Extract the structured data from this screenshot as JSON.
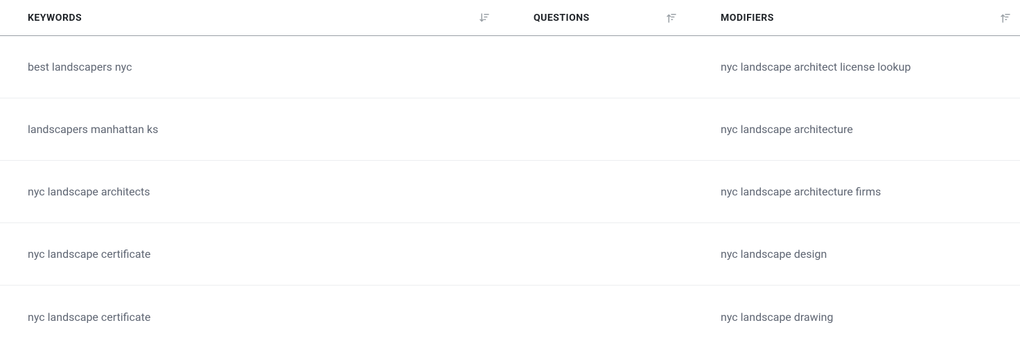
{
  "columns": {
    "keywords": {
      "label": "KEYWORDS"
    },
    "questions": {
      "label": "QUESTIONS"
    },
    "modifiers": {
      "label": "MODIFIERS"
    }
  },
  "rows": [
    {
      "keywords": "best landscapers nyc",
      "questions": "",
      "modifiers": "nyc landscape architect license lookup"
    },
    {
      "keywords": "landscapers manhattan ks",
      "questions": "",
      "modifiers": "nyc landscape architecture"
    },
    {
      "keywords": "nyc landscape architects",
      "questions": "",
      "modifiers": "nyc landscape architecture firms"
    },
    {
      "keywords": "nyc landscape certificate",
      "questions": "",
      "modifiers": "nyc landscape design"
    },
    {
      "keywords": "nyc landscape certificate",
      "questions": "",
      "modifiers": "nyc landscape drawing"
    }
  ]
}
